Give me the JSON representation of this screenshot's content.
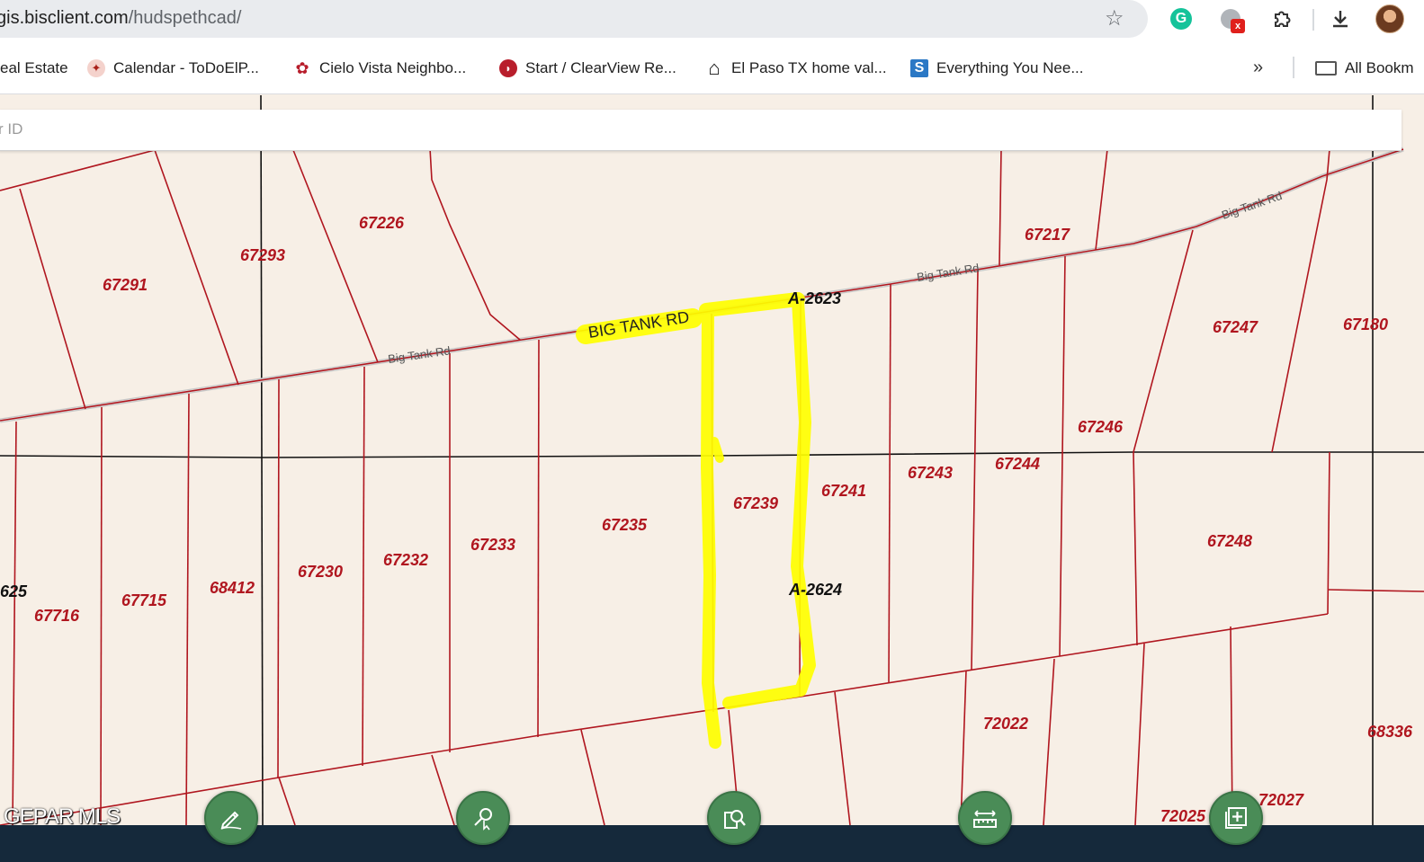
{
  "browser": {
    "url_host": "gis.bisclient.com",
    "url_path": "/hudspethcad/",
    "star_icon": "star-outline-icon",
    "extensions": [
      {
        "name": "grammarly",
        "glyph": "G",
        "color": "#15c39a"
      },
      {
        "name": "other-extension",
        "badge": "x",
        "badge_color": "#e0201c"
      }
    ]
  },
  "bookmarks": {
    "items": [
      {
        "label": "eal Estate",
        "icon": ""
      },
      {
        "label": "Calendar - ToDoElP...",
        "icon": "calendar-favicon"
      },
      {
        "label": "Cielo Vista Neighbo...",
        "icon": "cielo-vista-favicon"
      },
      {
        "label": "Start / ClearView Re...",
        "icon": "clearview-favicon"
      },
      {
        "label": "El Paso TX home val...",
        "icon": "house-icon"
      },
      {
        "label": "Everything You Nee...",
        "icon": "s-favicon"
      }
    ],
    "more_label": "»",
    "all_bookmarks_label": "All Bookm"
  },
  "search": {
    "placeholder": "r ID"
  },
  "map": {
    "parcels": [
      {
        "id": "67291"
      },
      {
        "id": "67293"
      },
      {
        "id": "67226"
      },
      {
        "id": "67217"
      },
      {
        "id": "67247"
      },
      {
        "id": "67180"
      },
      {
        "id": "67246"
      },
      {
        "id": "67244"
      },
      {
        "id": "67243"
      },
      {
        "id": "67241"
      },
      {
        "id": "67239"
      },
      {
        "id": "67235"
      },
      {
        "id": "67233"
      },
      {
        "id": "67232"
      },
      {
        "id": "67230"
      },
      {
        "id": "68412"
      },
      {
        "id": "67715"
      },
      {
        "id": "67716"
      },
      {
        "id": "67248"
      },
      {
        "id": "72022"
      },
      {
        "id": "68336"
      },
      {
        "id": "72027"
      },
      {
        "id": "72025"
      }
    ],
    "abstracts": [
      {
        "label": "A-2623"
      },
      {
        "label": "A-2624"
      },
      {
        "label": "625"
      }
    ],
    "roads": [
      {
        "label": "Big Tank Rd"
      },
      {
        "label": "Big Tank Rd"
      },
      {
        "label": "Big Tank Rd"
      }
    ],
    "highlight_label": "BIG TANK RD",
    "highlight_color": "#ffff00",
    "parcel_line_color": "#b0161f",
    "section_line_color": "#111111"
  },
  "toolbar": {
    "logo": "GEPAR MLS",
    "buttons": [
      {
        "name": "draw-tool-button",
        "icon": "pencil-icon"
      },
      {
        "name": "identify-tool-button",
        "icon": "identify-icon"
      },
      {
        "name": "search-tool-button",
        "icon": "search-document-icon"
      },
      {
        "name": "measure-tool-button",
        "icon": "ruler-icon"
      },
      {
        "name": "layers-tool-button",
        "icon": "add-layer-icon"
      }
    ]
  }
}
